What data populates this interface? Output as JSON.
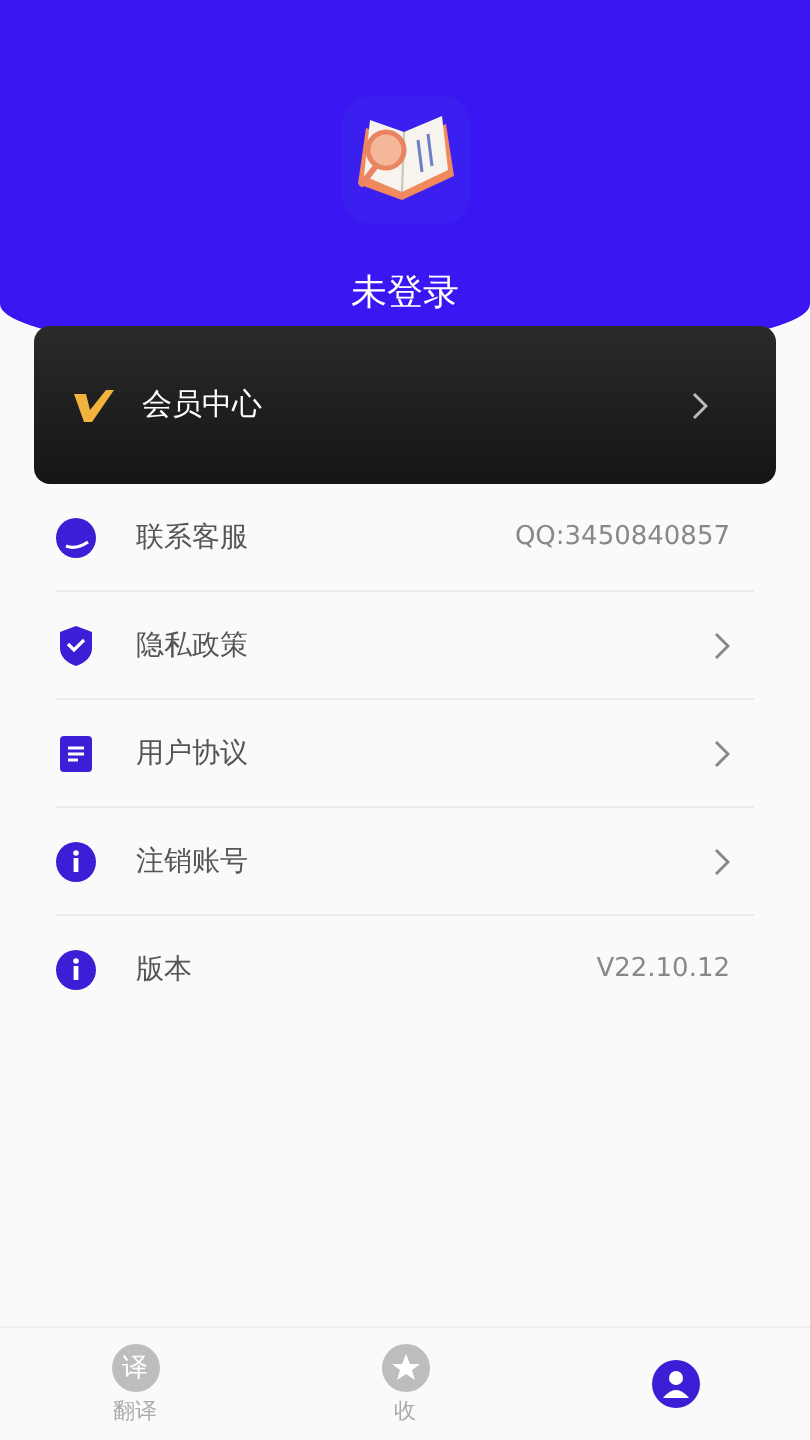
{
  "profile": {
    "name": "未登录"
  },
  "vip": {
    "label": "会员中心"
  },
  "menu": [
    {
      "kind": "contact",
      "label": "联系客服",
      "value": "QQ:3450840857"
    },
    {
      "kind": "privacy",
      "label": "隐私政策"
    },
    {
      "kind": "agreement",
      "label": "用户协议"
    },
    {
      "kind": "cancel",
      "label": "注销账号"
    },
    {
      "kind": "version",
      "label": "版本",
      "value": "V22.10.12"
    }
  ],
  "tabs": [
    {
      "kind": "translate",
      "icon_text": "译",
      "label": "翻译",
      "selected": false
    },
    {
      "kind": "favorite",
      "label": "收",
      "selected": false
    },
    {
      "kind": "profile",
      "selected": true
    }
  ]
}
